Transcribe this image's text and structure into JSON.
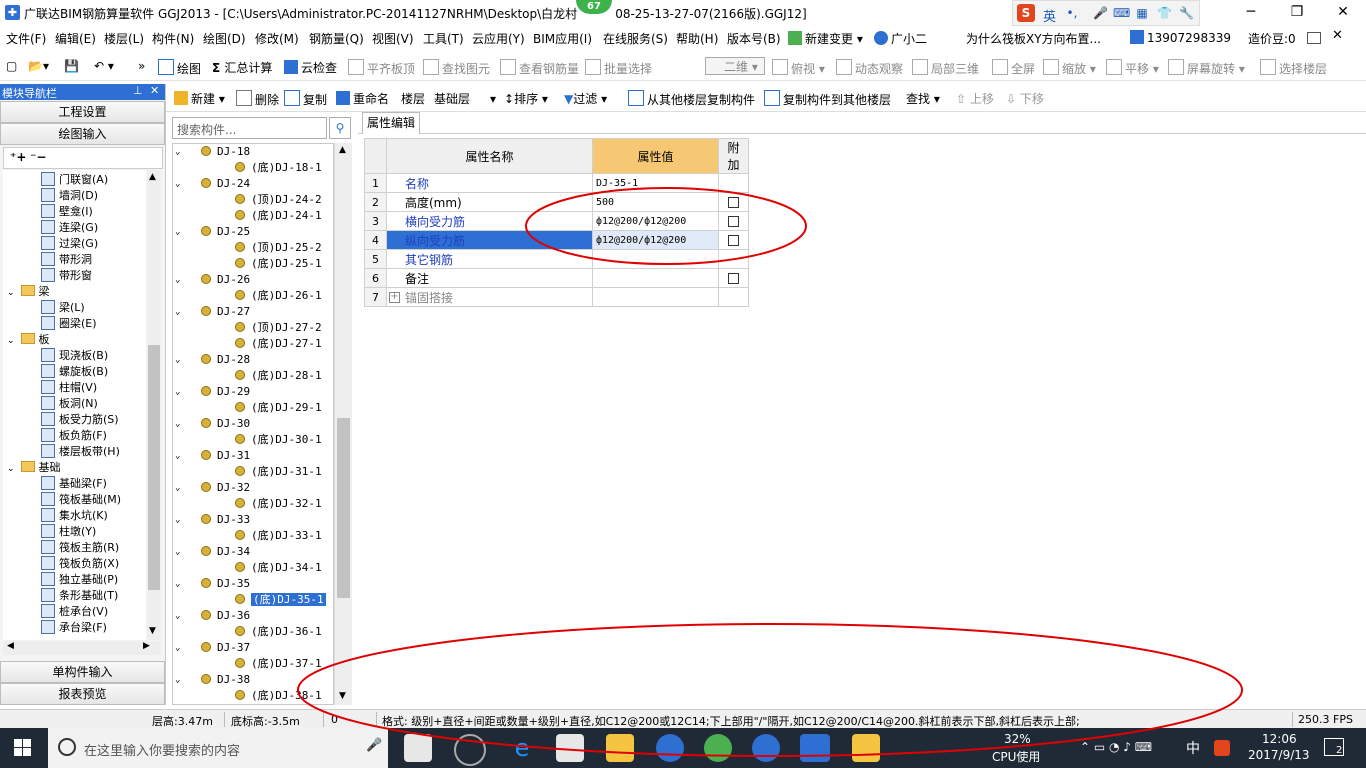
{
  "window": {
    "title": "广联达BIM钢筋算量软件 GGJ2013 - [C:\\Users\\Administrator.PC-20141127NRHM\\Desktop\\白龙村",
    "title_suffix": "08-25-13-27-07(2166版).GGJ12]",
    "badge": "67"
  },
  "ime": {
    "mode": "英"
  },
  "menu": {
    "items": [
      "文件(F)",
      "编辑(E)",
      "楼层(L)",
      "构件(N)",
      "绘图(D)",
      "修改(M)",
      "钢筋量(Q)",
      "视图(V)",
      "工具(T)",
      "云应用(Y)",
      "BIM应用(I)",
      "在线服务(S)",
      "帮助(H)",
      "版本号(B)"
    ],
    "new_change": "新建变更",
    "assistant": "广小二",
    "question": "为什么筏板XY方向布置...",
    "phone": "13907298339",
    "credits": "造价豆:0"
  },
  "toolbar1": {
    "draw": "绘图",
    "sum": "汇总计算",
    "cloud_check": "云检查",
    "align_top": "平齐板顶",
    "find_elem": "查找图元",
    "view_rebar": "查看钢筋量",
    "batch_select": "批量选择",
    "view_mode": "二维",
    "top_view": "俯视",
    "dynamic": "动态观察",
    "local3d": "局部三维",
    "fullscreen": "全屏",
    "zoom": "缩放",
    "pan": "平移",
    "rotate": "屏幕旋转",
    "select_floor": "选择楼层"
  },
  "nav": {
    "title": "模块导航栏",
    "project_settings": "工程设置",
    "draw_input": "绘图输入",
    "tree": [
      {
        "label": "门联窗(A)",
        "type": "item"
      },
      {
        "label": "墙洞(D)",
        "type": "item"
      },
      {
        "label": "壁龛(I)",
        "type": "item"
      },
      {
        "label": "连梁(G)",
        "type": "item"
      },
      {
        "label": "过梁(G)",
        "type": "item"
      },
      {
        "label": "带形洞",
        "type": "item"
      },
      {
        "label": "带形窗",
        "type": "item"
      },
      {
        "label": "梁",
        "type": "folder"
      },
      {
        "label": "梁(L)",
        "type": "item"
      },
      {
        "label": "圈梁(E)",
        "type": "item"
      },
      {
        "label": "板",
        "type": "folder"
      },
      {
        "label": "现浇板(B)",
        "type": "item"
      },
      {
        "label": "螺旋板(B)",
        "type": "item"
      },
      {
        "label": "柱帽(V)",
        "type": "item"
      },
      {
        "label": "板洞(N)",
        "type": "item"
      },
      {
        "label": "板受力筋(S)",
        "type": "item"
      },
      {
        "label": "板负筋(F)",
        "type": "item"
      },
      {
        "label": "楼层板带(H)",
        "type": "item"
      },
      {
        "label": "基础",
        "type": "folder"
      },
      {
        "label": "基础梁(F)",
        "type": "item"
      },
      {
        "label": "筏板基础(M)",
        "type": "item"
      },
      {
        "label": "集水坑(K)",
        "type": "item"
      },
      {
        "label": "柱墩(Y)",
        "type": "item"
      },
      {
        "label": "筏板主筋(R)",
        "type": "item"
      },
      {
        "label": "筏板负筋(X)",
        "type": "item"
      },
      {
        "label": "独立基础(P)",
        "type": "item"
      },
      {
        "label": "条形基础(T)",
        "type": "item"
      },
      {
        "label": "桩承台(V)",
        "type": "item"
      },
      {
        "label": "承台梁(F)",
        "type": "item"
      }
    ],
    "single_input": "单构件输入",
    "report_preview": "报表预览"
  },
  "toolbar2": {
    "new": "新建",
    "delete": "删除",
    "copy": "复制",
    "rename": "重命名",
    "floor_label": "楼层",
    "floor_value": "基础层",
    "sort": "排序",
    "filter": "过滤",
    "copy_from": "从其他楼层复制构件",
    "copy_to": "复制构件到其他楼层",
    "find": "查找",
    "up": "上移",
    "down": "下移"
  },
  "search": {
    "placeholder": "搜索构件..."
  },
  "tree": [
    {
      "label": "DJ-18",
      "level": 0
    },
    {
      "label": "(底)DJ-18-1",
      "level": 1
    },
    {
      "label": "DJ-24",
      "level": 0
    },
    {
      "label": "(顶)DJ-24-2",
      "level": 1
    },
    {
      "label": "(底)DJ-24-1",
      "level": 1
    },
    {
      "label": "DJ-25",
      "level": 0
    },
    {
      "label": "(顶)DJ-25-2",
      "level": 1
    },
    {
      "label": "(底)DJ-25-1",
      "level": 1
    },
    {
      "label": "DJ-26",
      "level": 0
    },
    {
      "label": "(底)DJ-26-1",
      "level": 1
    },
    {
      "label": "DJ-27",
      "level": 0
    },
    {
      "label": "(顶)DJ-27-2",
      "level": 1
    },
    {
      "label": "(底)DJ-27-1",
      "level": 1
    },
    {
      "label": "DJ-28",
      "level": 0
    },
    {
      "label": "(底)DJ-28-1",
      "level": 1
    },
    {
      "label": "DJ-29",
      "level": 0
    },
    {
      "label": "(底)DJ-29-1",
      "level": 1
    },
    {
      "label": "DJ-30",
      "level": 0
    },
    {
      "label": "(底)DJ-30-1",
      "level": 1
    },
    {
      "label": "DJ-31",
      "level": 0
    },
    {
      "label": "(底)DJ-31-1",
      "level": 1
    },
    {
      "label": "DJ-32",
      "level": 0
    },
    {
      "label": "(底)DJ-32-1",
      "level": 1
    },
    {
      "label": "DJ-33",
      "level": 0
    },
    {
      "label": "(底)DJ-33-1",
      "level": 1
    },
    {
      "label": "DJ-34",
      "level": 0
    },
    {
      "label": "(底)DJ-34-1",
      "level": 1
    },
    {
      "label": "DJ-35",
      "level": 0
    },
    {
      "label": "(底)DJ-35-1",
      "level": 1,
      "selected": true
    },
    {
      "label": "DJ-36",
      "level": 0
    },
    {
      "label": "(底)DJ-36-1",
      "level": 1
    },
    {
      "label": "DJ-37",
      "level": 0
    },
    {
      "label": "(底)DJ-37-1",
      "level": 1
    },
    {
      "label": "DJ-38",
      "level": 0
    },
    {
      "label": "(底)DJ-38-1",
      "level": 1
    }
  ],
  "props": {
    "tab": "属性编辑",
    "header_name": "属性名称",
    "header_value": "属性值",
    "header_add": "附加",
    "rows": [
      {
        "num": "1",
        "name": "名称",
        "value": "DJ-35-1",
        "style": "blue",
        "checkbox": false
      },
      {
        "num": "2",
        "name": "高度(mm)",
        "value": "500",
        "style": "",
        "checkbox": true
      },
      {
        "num": "3",
        "name": "横向受力筋",
        "value": "ф12@200/ф12@200",
        "style": "blue",
        "checkbox": true
      },
      {
        "num": "4",
        "name": "纵向受力筋",
        "value": "ф12@200/ф12@200",
        "style": "blue",
        "checkbox": true,
        "selected": true
      },
      {
        "num": "5",
        "name": "其它钢筋",
        "value": "",
        "style": "blue",
        "checkbox": false
      },
      {
        "num": "6",
        "name": "备注",
        "value": "",
        "style": "",
        "checkbox": true
      },
      {
        "num": "7",
        "name": "锚固搭接",
        "value": "",
        "style": "gray",
        "checkbox": false,
        "expand": "+"
      }
    ]
  },
  "status": {
    "floor_height": "层高:3.47m",
    "bottom_elev": "底标高:-3.5m",
    "zero": "0",
    "hint": "格式: 级别+直径+间距或数量+级别+直径,如C12@200或12C14;下上部用\"/\"隔开,如C12@200/C14@200.斜杠前表示下部,斜杠后表示上部;",
    "fps": "250.3 FPS"
  },
  "taskbar": {
    "search_placeholder": "在这里输入你要搜索的内容",
    "cpu_percent": "32%",
    "cpu_label": "CPU使用",
    "ime": "中",
    "time": "12:06",
    "date": "2017/9/13",
    "notifications": "2"
  },
  "colors": {
    "accent": "#2d6fd2",
    "header_value_bg": "#f7c873",
    "annotation": "#e00000",
    "taskbar": "#1f2a36"
  }
}
